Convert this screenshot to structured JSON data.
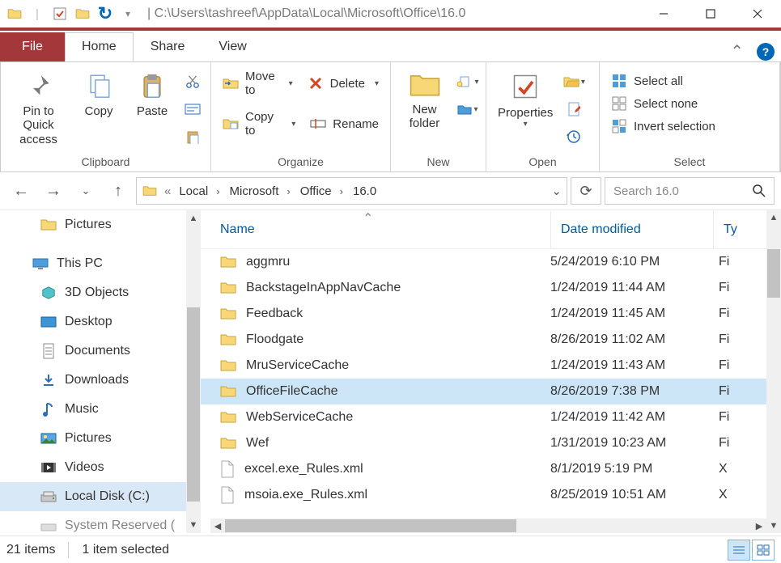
{
  "titlebar": {
    "path": "|   C:\\Users\\tashreef\\AppData\\Local\\Microsoft\\Office\\16.0"
  },
  "tabs": {
    "file": "File",
    "home": "Home",
    "share": "Share",
    "view": "View"
  },
  "ribbon": {
    "clipboard": {
      "label": "Clipboard",
      "pin": "Pin to Quick access",
      "copy": "Copy",
      "paste": "Paste"
    },
    "organize": {
      "label": "Organize",
      "moveto": "Move to",
      "copyto": "Copy to",
      "delete": "Delete",
      "rename": "Rename"
    },
    "new": {
      "label": "New",
      "newfolder": "New folder"
    },
    "open": {
      "label": "Open",
      "properties": "Properties"
    },
    "select": {
      "label": "Select",
      "all": "Select all",
      "none": "Select none",
      "invert": "Invert selection"
    }
  },
  "breadcrumb": {
    "parts": [
      "Local",
      "Microsoft",
      "Office",
      "16.0"
    ]
  },
  "search": {
    "placeholder": "Search 16.0"
  },
  "sidebar": {
    "pictures": "Pictures",
    "thispc": "This PC",
    "objects3d": "3D Objects",
    "desktop": "Desktop",
    "documents": "Documents",
    "downloads": "Downloads",
    "music": "Music",
    "pictures2": "Pictures",
    "videos": "Videos",
    "localdisk": "Local Disk (C:)",
    "sysres": "System Reserved ("
  },
  "columns": {
    "name": "Name",
    "date": "Date modified",
    "type": "Ty"
  },
  "files": [
    {
      "name": "aggmru",
      "date": "5/24/2019 6:10 PM",
      "type": "Fi",
      "kind": "folder"
    },
    {
      "name": "BackstageInAppNavCache",
      "date": "1/24/2019 11:44 AM",
      "type": "Fi",
      "kind": "folder"
    },
    {
      "name": "Feedback",
      "date": "1/24/2019 11:45 AM",
      "type": "Fi",
      "kind": "folder"
    },
    {
      "name": "Floodgate",
      "date": "8/26/2019 11:02 AM",
      "type": "Fi",
      "kind": "folder"
    },
    {
      "name": "MruServiceCache",
      "date": "1/24/2019 11:43 AM",
      "type": "Fi",
      "kind": "folder"
    },
    {
      "name": "OfficeFileCache",
      "date": "8/26/2019 7:38 PM",
      "type": "Fi",
      "kind": "folder",
      "selected": true
    },
    {
      "name": "WebServiceCache",
      "date": "1/24/2019 11:42 AM",
      "type": "Fi",
      "kind": "folder"
    },
    {
      "name": "Wef",
      "date": "1/31/2019 10:23 AM",
      "type": "Fi",
      "kind": "folder"
    },
    {
      "name": "excel.exe_Rules.xml",
      "date": "8/1/2019 5:19 PM",
      "type": "X",
      "kind": "file"
    },
    {
      "name": "msoia.exe_Rules.xml",
      "date": "8/25/2019 10:51 AM",
      "type": "X",
      "kind": "file"
    }
  ],
  "status": {
    "count": "21 items",
    "selected": "1 item selected"
  }
}
